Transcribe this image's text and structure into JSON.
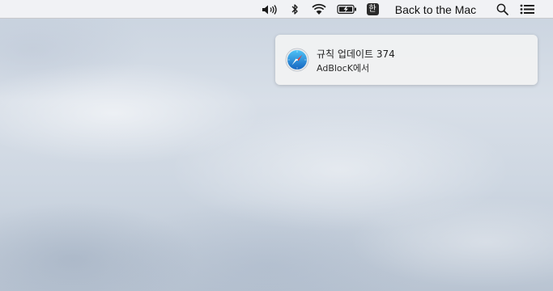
{
  "menubar": {
    "status_icons": [
      {
        "name": "volume-icon"
      },
      {
        "name": "bluetooth-icon"
      },
      {
        "name": "wifi-icon"
      },
      {
        "name": "battery-charging-icon"
      }
    ],
    "input_method": "한",
    "app_label": "Back to the Mac",
    "spotlight_icon": "search-icon",
    "notification_center_icon": "list-icon"
  },
  "notification": {
    "app_icon": "safari-compass-icon",
    "title": "규칙 업데이트 374",
    "subtitle": "AdBlocK에서",
    "accent_color": "#1e88e5"
  }
}
